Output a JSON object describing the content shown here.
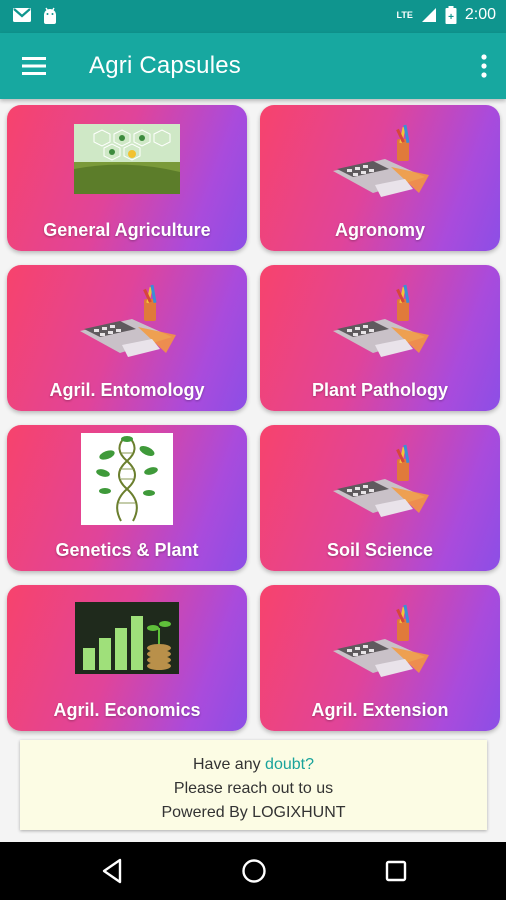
{
  "status_bar": {
    "time": "2:00",
    "network": "LTE",
    "icons": [
      "gmail-icon",
      "android-icon",
      "signal-icon",
      "battery-icon"
    ]
  },
  "app_bar": {
    "title": "Agri Capsules",
    "menu_icon": "hamburger-menu-icon",
    "more_icon": "more-vertical-icon"
  },
  "cards": [
    {
      "label": "General Agriculture",
      "image": "farm-technology-image"
    },
    {
      "label": "Agronomy",
      "image": "stationery-calculator-image"
    },
    {
      "label": "Agril. Entomology",
      "image": "stationery-calculator-image"
    },
    {
      "label": "Plant Pathology",
      "image": "stationery-calculator-image"
    },
    {
      "label": "Genetics & Plant",
      "image": "dna-plant-image"
    },
    {
      "label": "Soil Science",
      "image": "stationery-calculator-image"
    },
    {
      "label": "Agril. Economics",
      "image": "coins-plants-image"
    },
    {
      "label": "Agril. Extension",
      "image": "stationery-calculator-image"
    }
  ],
  "info": {
    "line1_prefix": "Have any ",
    "line1_link": "doubt?",
    "line2": "Please reach out to us",
    "line3": "Powered By LOGIXHUNT"
  },
  "nav": {
    "back": "back-icon",
    "home": "home-icon",
    "recents": "recents-icon"
  },
  "colors": {
    "status_bar": "#0f958e",
    "app_bar": "#17a8a0",
    "card_gradient_start": "#f7436c",
    "card_gradient_end": "#8c4ee6",
    "info_background": "#fcfce4",
    "link": "#18a39b"
  }
}
